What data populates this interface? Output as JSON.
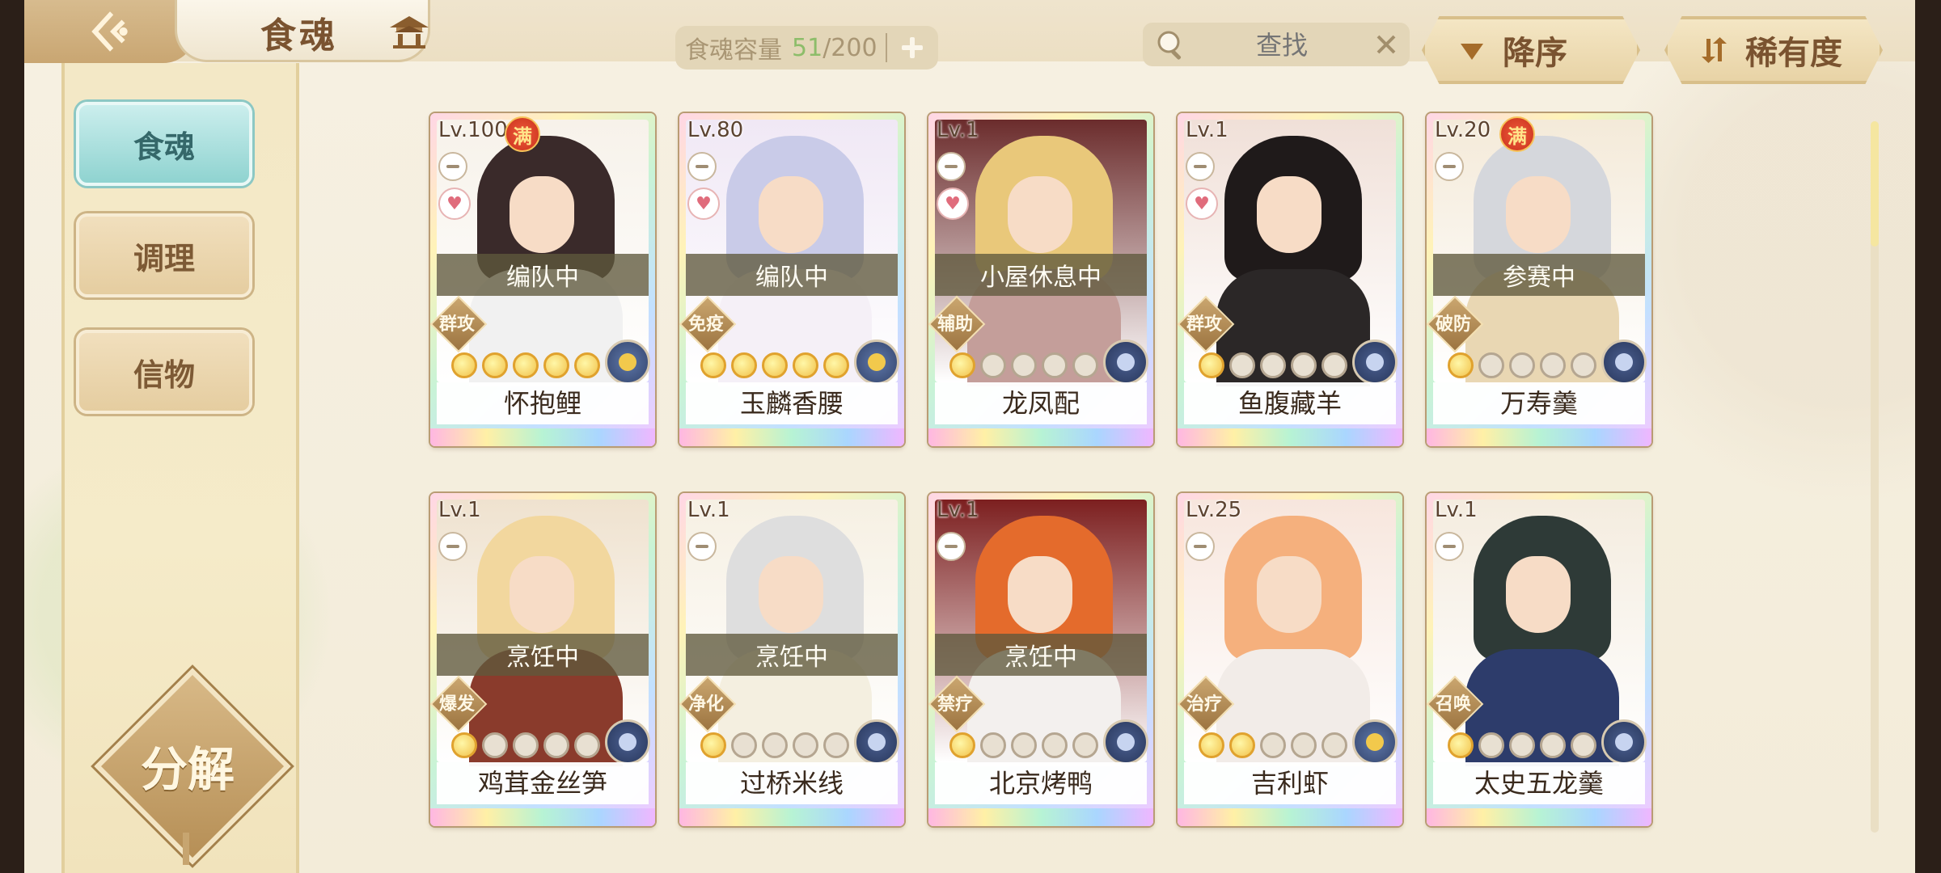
{
  "header": {
    "title": "食魂",
    "capacity": {
      "label": "食魂容量",
      "current": "51",
      "max": "/200"
    },
    "search": {
      "placeholder": "查找"
    },
    "sort_label": "降序",
    "filter_label": "稀有度"
  },
  "sidebar": {
    "items": [
      {
        "label": "食魂",
        "active": true
      },
      {
        "label": "调理",
        "active": false
      },
      {
        "label": "信物",
        "active": false
      }
    ],
    "dismantle_label": "分解"
  },
  "colors": {
    "accent_teal": "#8fd3d0",
    "gold": "#c9a672",
    "status_overlay": "#5f583c"
  },
  "cards": [
    {
      "level": "Lv.100",
      "full": "满",
      "status": "编队中",
      "role": "群攻",
      "name": "怀抱鲤",
      "stars": 5,
      "heart": true,
      "element_icon": "gold-flower-icon"
    },
    {
      "level": "Lv.80",
      "full": "",
      "status": "编队中",
      "role": "免疫",
      "name": "玉麟香腰",
      "stars": 5,
      "heart": true,
      "element_icon": "gold-flower-icon"
    },
    {
      "level": "Lv.1",
      "full": "",
      "status": "小屋休息中",
      "role": "辅助",
      "name": "龙凤配",
      "stars": 1,
      "heart": true,
      "element_icon": "blue-flower-icon"
    },
    {
      "level": "Lv.1",
      "full": "",
      "status": "",
      "role": "群攻",
      "name": "鱼腹藏羊",
      "stars": 1,
      "heart": true,
      "element_icon": "blue-flower-icon"
    },
    {
      "level": "Lv.20",
      "full": "满",
      "status": "参赛中",
      "role": "破防",
      "name": "万寿羹",
      "stars": 1,
      "heart": false,
      "element_icon": "blue-flower-icon"
    },
    {
      "level": "Lv.1",
      "full": "",
      "status": "烹饪中",
      "role": "爆发",
      "name": "鸡茸金丝笋",
      "stars": 1,
      "heart": false,
      "element_icon": "blue-flower-icon"
    },
    {
      "level": "Lv.1",
      "full": "",
      "status": "烹饪中",
      "role": "净化",
      "name": "过桥米线",
      "stars": 1,
      "heart": false,
      "element_icon": "blue-flower-icon"
    },
    {
      "level": "Lv.1",
      "full": "",
      "status": "烹饪中",
      "role": "禁疗",
      "name": "北京烤鸭",
      "stars": 1,
      "heart": false,
      "element_icon": "blue-flower-icon"
    },
    {
      "level": "Lv.25",
      "full": "",
      "status": "",
      "role": "治疗",
      "name": "吉利虾",
      "stars": 2,
      "heart": false,
      "element_icon": "gold-flower-icon"
    },
    {
      "level": "Lv.1",
      "full": "",
      "status": "",
      "role": "召唤",
      "name": "太史五龙羹",
      "stars": 1,
      "heart": false,
      "element_icon": "blue-flower-icon"
    }
  ]
}
